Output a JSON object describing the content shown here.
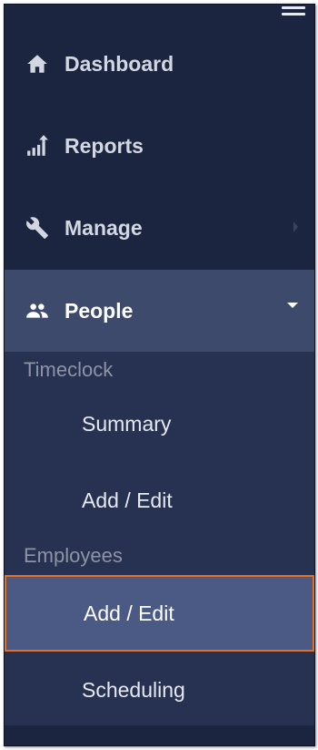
{
  "nav": {
    "items": [
      {
        "label": "Dashboard",
        "icon": "home-icon"
      },
      {
        "label": "Reports",
        "icon": "bar-chart-icon"
      },
      {
        "label": "Manage",
        "icon": "wrench-icon"
      },
      {
        "label": "People",
        "icon": "people-icon",
        "expanded": true
      }
    ]
  },
  "submenu": {
    "timeclock": {
      "label": "Timeclock",
      "items": [
        {
          "label": "Summary"
        },
        {
          "label": "Add / Edit"
        }
      ]
    },
    "employees": {
      "label": "Employees",
      "items": [
        {
          "label": "Add / Edit",
          "selected": true
        },
        {
          "label": "Scheduling"
        }
      ]
    }
  },
  "colors": {
    "sidebar_bg": "#1b2540",
    "active_item_bg": "#3d4a6b",
    "submenu_bg": "#273151",
    "selected_bg": "#4a5a85",
    "selection_outline": "#e46f25"
  }
}
